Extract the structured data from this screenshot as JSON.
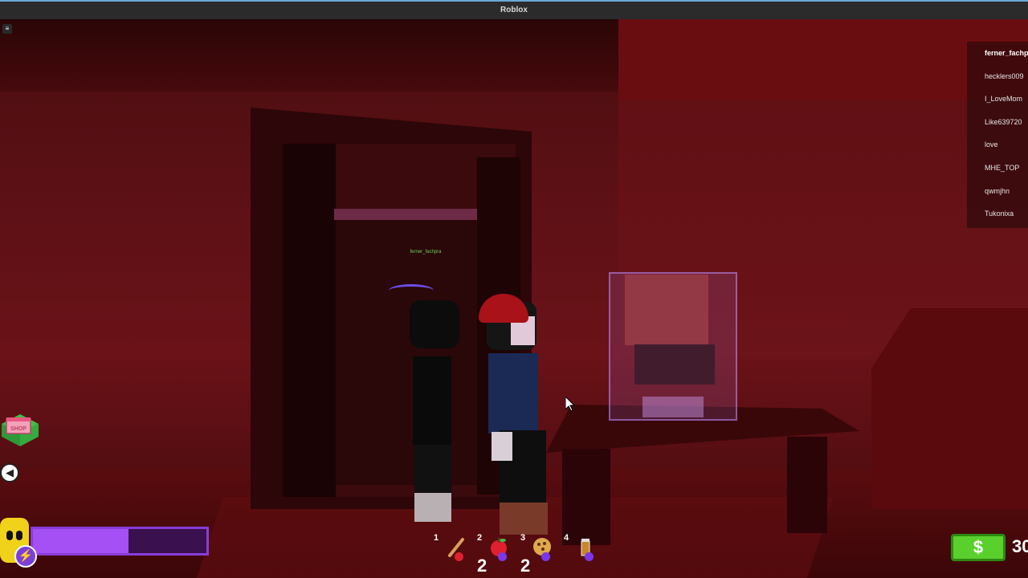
{
  "window": {
    "title": "Roblox"
  },
  "game": {
    "character_nametag": "ferner_fachpra"
  },
  "player_list": [
    "ferner_fachpra",
    "hecklers009",
    "I_LoveMom",
    "Like639720",
    "love",
    "MHE_TOP",
    "qwmjhn",
    "Tukonixa"
  ],
  "hud": {
    "shop_label": "SHOP",
    "energy_fraction": 0.55,
    "hotbar": [
      {
        "slot": "1",
        "item": "baseball-bat-icon",
        "count": "",
        "dot_color": "#e02030"
      },
      {
        "slot": "2",
        "item": "apple-icon",
        "count": "2",
        "dot_color": "#7a38e8"
      },
      {
        "slot": "3",
        "item": "cookie-icon",
        "count": "2",
        "dot_color": "#7a38e8"
      },
      {
        "slot": "4",
        "item": "drink-icon",
        "count": "",
        "dot_color": "#7a38e8"
      }
    ],
    "money_symbol": "$",
    "money_amount": "30"
  },
  "colors": {
    "energy": "#a450f4",
    "money": "#5ad02c"
  }
}
